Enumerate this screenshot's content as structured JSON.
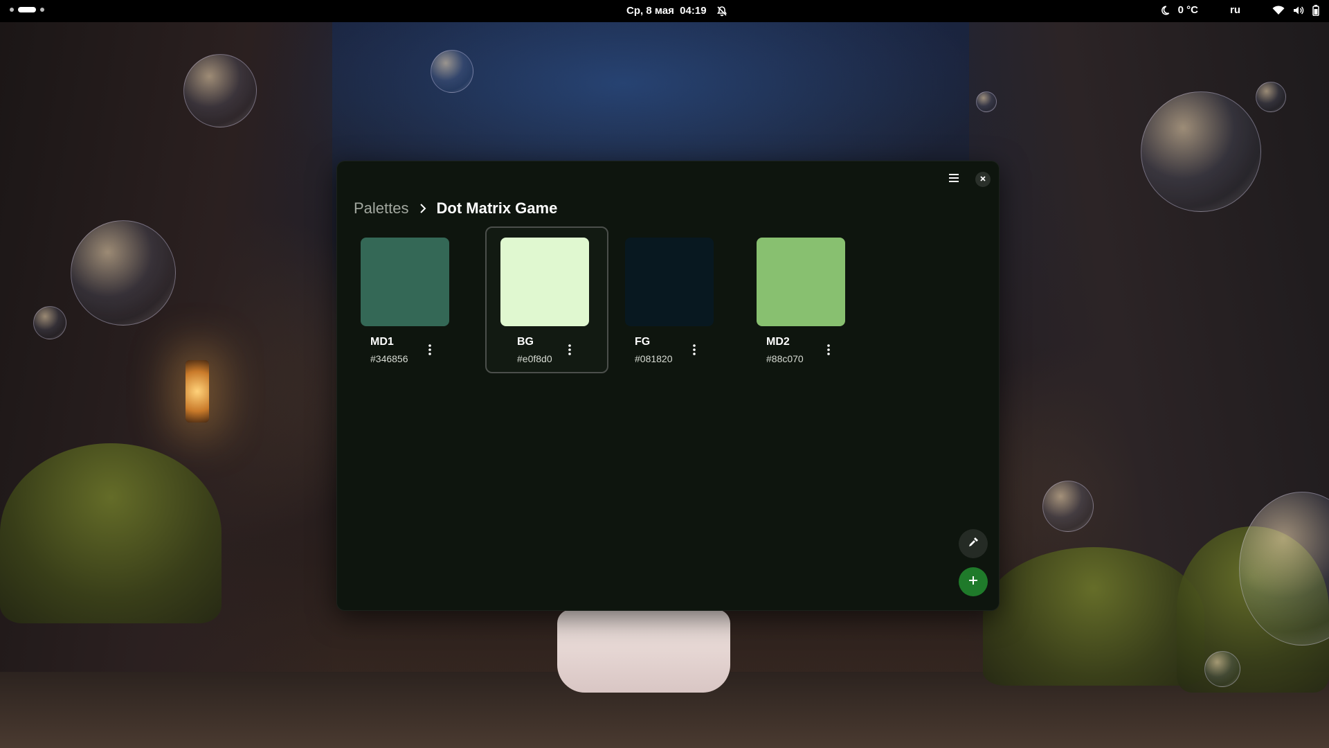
{
  "topbar": {
    "datetime": "Ср, 8 мая  04:19",
    "weather": "0 °C",
    "keyboard_layout": "ru",
    "icons": [
      "notifications-off-icon",
      "night-icon",
      "wifi-icon",
      "volume-icon",
      "battery-icon"
    ]
  },
  "window": {
    "breadcrumb": {
      "parent": "Palettes",
      "current": "Dot Matrix Game"
    },
    "colors": [
      {
        "name": "MD1",
        "hex": "#346856",
        "swatch": "#346856"
      },
      {
        "name": "BG",
        "hex": "#e0f8d0",
        "swatch": "#e0f8d0",
        "selected": true
      },
      {
        "name": "FG",
        "hex": "#081820",
        "swatch": "#081820"
      },
      {
        "name": "MD2",
        "hex": "#88c070",
        "swatch": "#88c070"
      }
    ],
    "accent": "#1f7a2a",
    "window_bg": "#0e150e"
  }
}
